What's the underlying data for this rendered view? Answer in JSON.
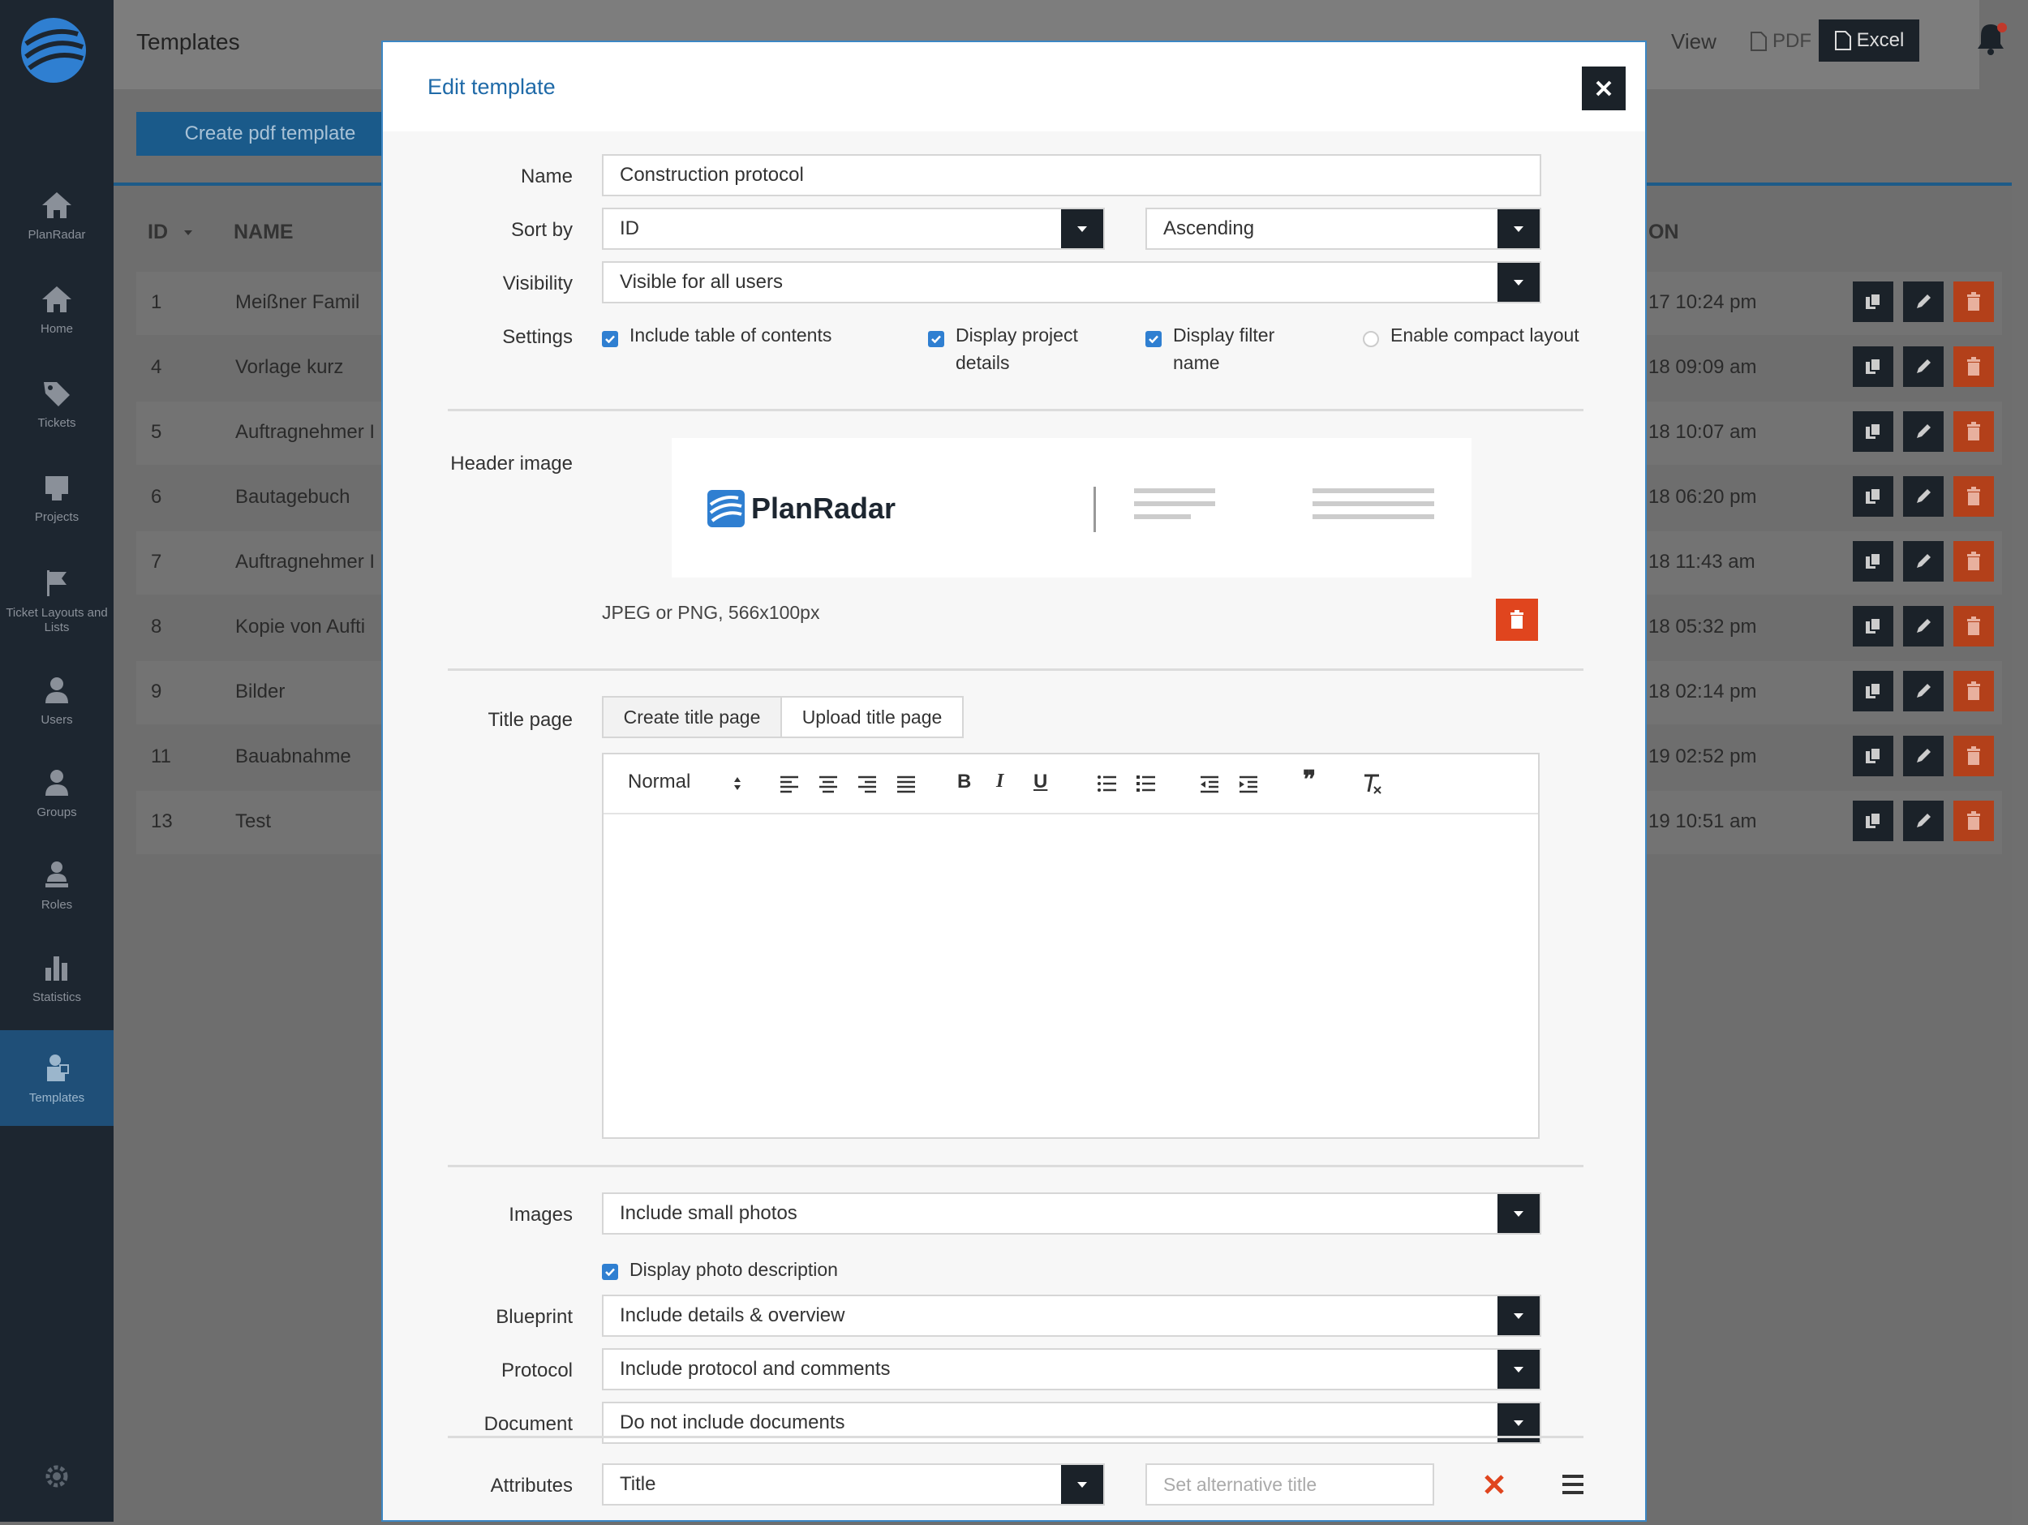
{
  "sidebar": {
    "items": [
      {
        "label": "PlanRadar",
        "icon": "home-icon"
      },
      {
        "label": "Home",
        "icon": "home-icon"
      },
      {
        "label": "Tickets",
        "icon": "tag-icon"
      },
      {
        "label": "Projects",
        "icon": "projects-icon"
      },
      {
        "label": "Ticket Layouts and Lists",
        "icon": "flag-icon"
      },
      {
        "label": "Users",
        "icon": "user-icon"
      },
      {
        "label": "Groups",
        "icon": "group-icon"
      },
      {
        "label": "Roles",
        "icon": "role-icon"
      },
      {
        "label": "Statistics",
        "icon": "bar-chart-icon"
      },
      {
        "label": "Templates",
        "icon": "template-icon"
      }
    ]
  },
  "topbar": {
    "title": "Templates",
    "view_label": "View",
    "pdf_label": "PDF",
    "excel_label": "Excel"
  },
  "actions": {
    "create_pdf_label": "Create pdf template"
  },
  "table": {
    "headers": {
      "id": "ID",
      "name": "NAME",
      "date": "ON"
    },
    "rows": [
      {
        "id": "1",
        "name": "Meißner Famil",
        "date": "17 10:24 pm"
      },
      {
        "id": "4",
        "name": "Vorlage kurz",
        "date": "18 09:09 am"
      },
      {
        "id": "5",
        "name": "Auftragnehmer I",
        "date": "18 10:07 am"
      },
      {
        "id": "6",
        "name": "Bautagebuch",
        "date": "18 06:20 pm"
      },
      {
        "id": "7",
        "name": "Auftragnehmer I",
        "date": "18 11:43 am"
      },
      {
        "id": "8",
        "name": "Kopie von Aufti",
        "date": "18 05:32 pm"
      },
      {
        "id": "9",
        "name": "Bilder",
        "date": "18 02:14 pm"
      },
      {
        "id": "11",
        "name": "Bauabnahme",
        "date": "19 02:52 pm"
      },
      {
        "id": "13",
        "name": "Test",
        "date": "19 10:51 am"
      }
    ]
  },
  "modal": {
    "title": "Edit template",
    "labels": {
      "name": "Name",
      "sort_by": "Sort by",
      "visibility": "Visibility",
      "settings": "Settings",
      "header_image": "Header image",
      "title_page": "Title page",
      "images": "Images",
      "blueprint": "Blueprint",
      "protocol": "Protocol",
      "document": "Document",
      "attributes": "Attributes"
    },
    "name_value": "Construction protocol",
    "sort_by_value": "ID",
    "sort_order_value": "Ascending",
    "visibility_value": "Visible for all users",
    "settings": [
      {
        "label": "Include table of contents",
        "checked": true
      },
      {
        "label": "Display project details",
        "checked": true
      },
      {
        "label": "Display filter name",
        "checked": true
      },
      {
        "label": "Enable compact layout",
        "checked": false
      }
    ],
    "header_logo_text": "PlanRadar",
    "header_hint": "JPEG or PNG, 566x100px",
    "title_tabs": [
      "Create title page",
      "Upload title page"
    ],
    "editor_format": "Normal",
    "images_value": "Include small photos",
    "display_photo_description": "Display photo description",
    "blueprint_value": "Include details & overview",
    "protocol_value": "Include protocol and comments",
    "document_value": "Do not include documents",
    "attribute_value": "Title",
    "alt_title_placeholder": "Set alternative title"
  },
  "colors": {
    "accent": "#1f6aa8",
    "sidebar": "#1d2630",
    "danger": "#e0451e",
    "dark_button": "#1b2229"
  }
}
